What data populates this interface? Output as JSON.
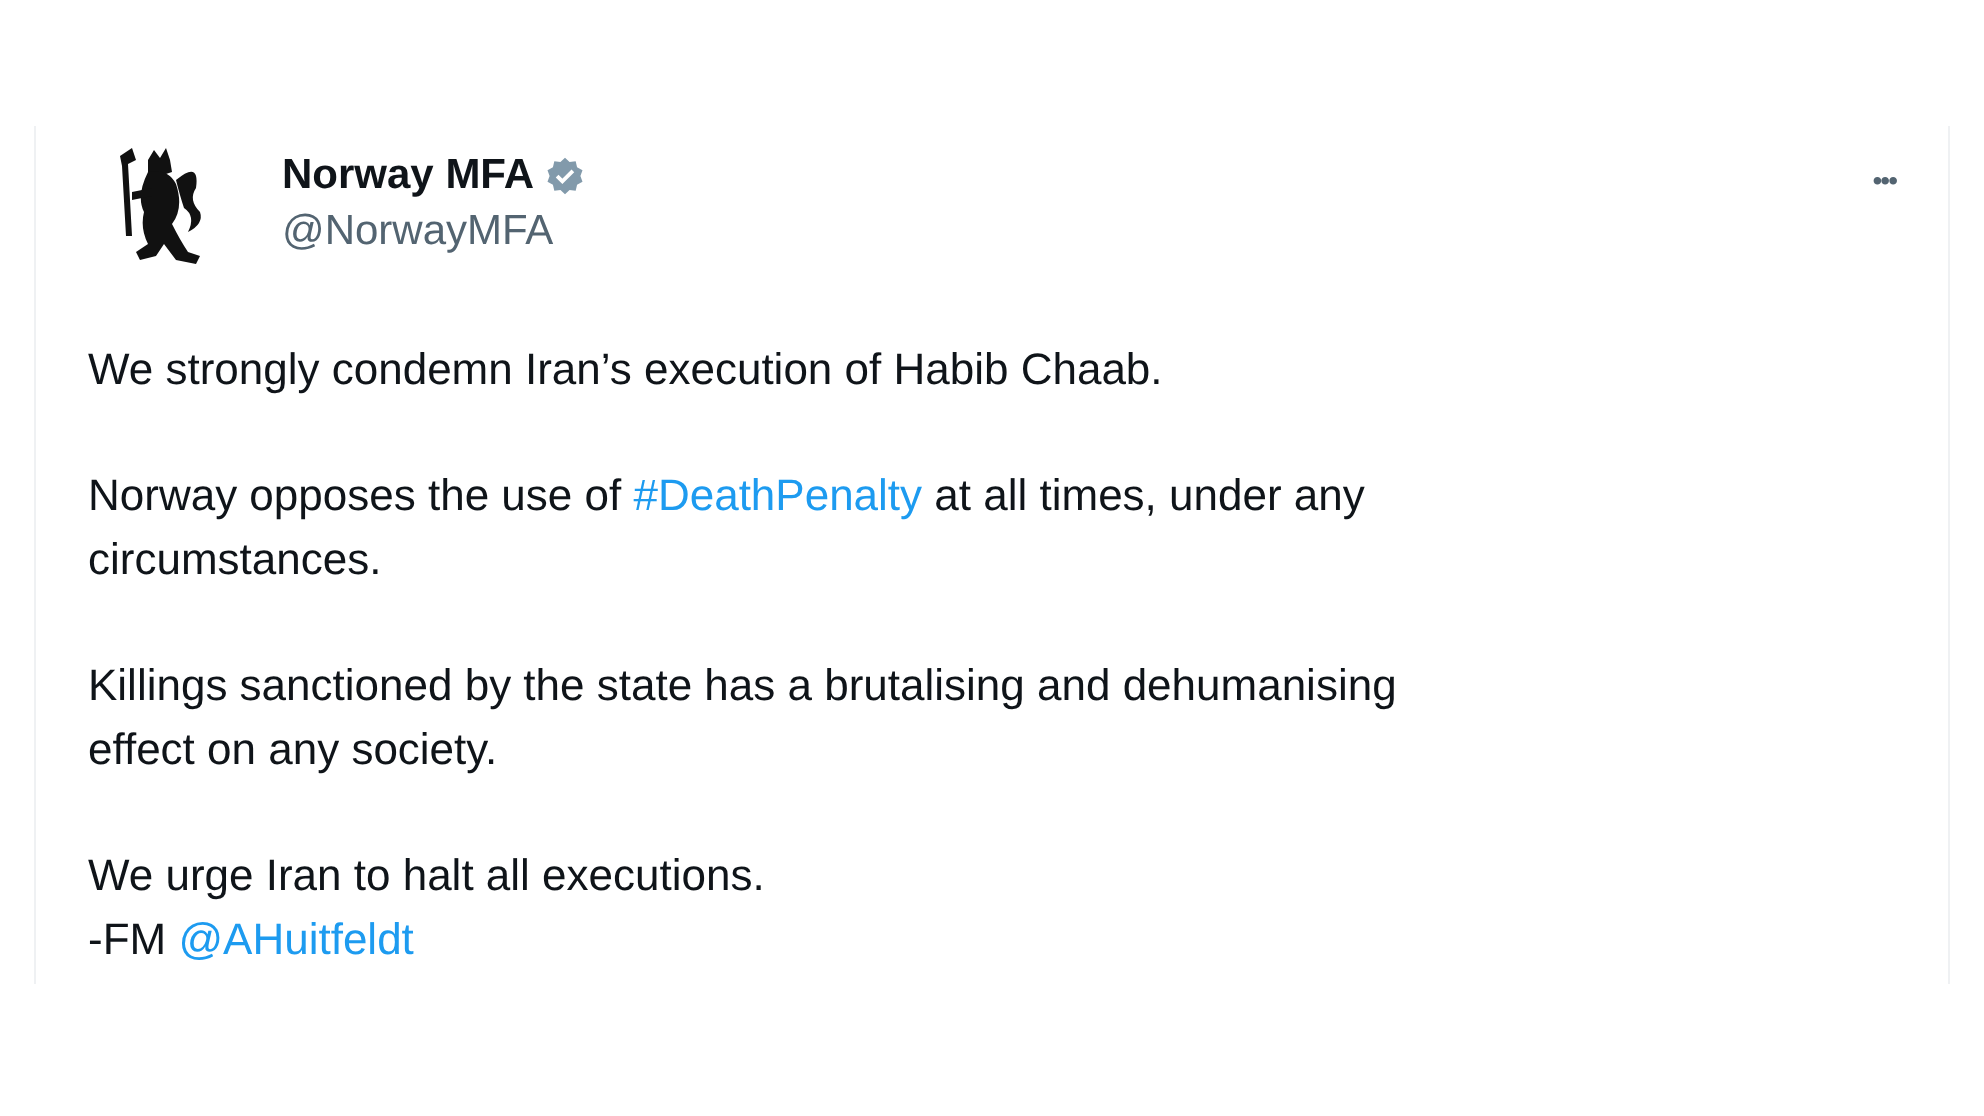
{
  "tweet": {
    "author": {
      "name": "Norway MFA",
      "verified": true,
      "handle": "@NorwayMFA"
    },
    "more_button": "•••",
    "paragraphs": [
      {
        "lines": [
          [
            {
              "kind": "text",
              "text": "We strongly condemn Iran’s execution of Habib Chaab."
            }
          ]
        ]
      },
      {
        "lines": [
          [
            {
              "kind": "text",
              "text": "Norway opposes the use of "
            },
            {
              "kind": "hashtag",
              "text": "#DeathPenalty"
            },
            {
              "kind": "text",
              "text": " at all times, under any"
            }
          ],
          [
            {
              "kind": "text",
              "text": "circumstances."
            }
          ]
        ]
      },
      {
        "lines": [
          [
            {
              "kind": "text",
              "text": "Killings sanctioned by the state has a brutalising and dehumanising"
            }
          ],
          [
            {
              "kind": "text",
              "text": "effect on any society."
            }
          ]
        ]
      },
      {
        "lines": [
          [
            {
              "kind": "text",
              "text": "We urge Iran to halt all executions."
            }
          ],
          [
            {
              "kind": "text",
              "text": "-FM "
            },
            {
              "kind": "mention",
              "text": "@AHuitfeldt"
            }
          ]
        ]
      }
    ]
  }
}
